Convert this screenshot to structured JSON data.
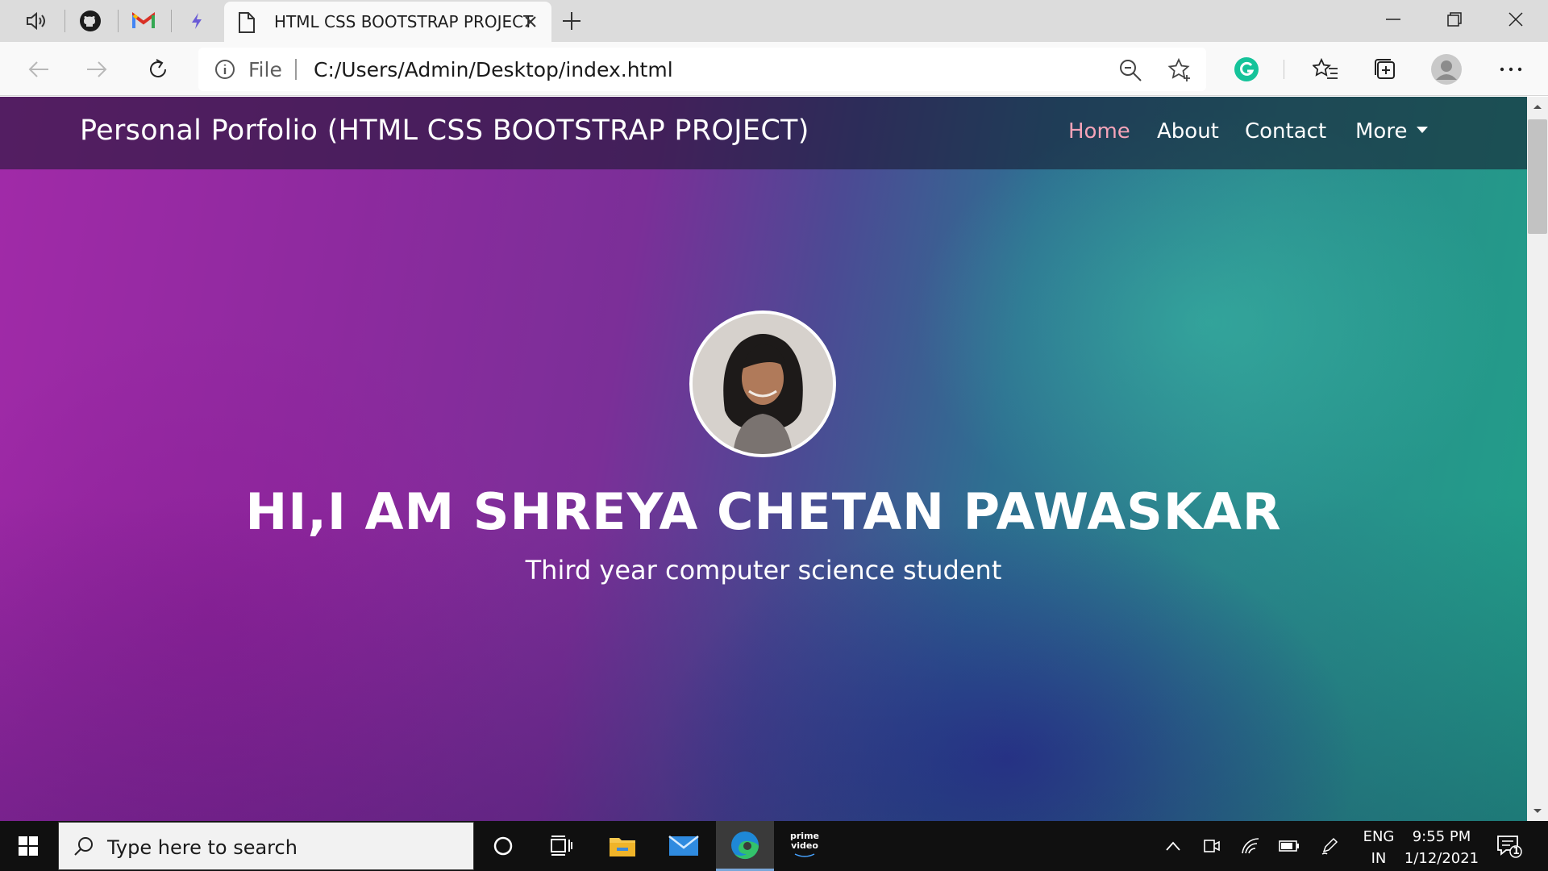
{
  "browser": {
    "tab_title": "HTML CSS BOOTSTRAP PROJECT",
    "omnibox_scheme": "File",
    "url": "C:/Users/Admin/Desktop/index.html"
  },
  "page": {
    "brand": "Personal Porfolio (HTML CSS BOOTSTRAP PROJECT)",
    "nav": [
      {
        "label": "Home",
        "active": true
      },
      {
        "label": "About",
        "active": false
      },
      {
        "label": "Contact",
        "active": false
      },
      {
        "label": "More",
        "active": false
      }
    ],
    "hero_title": "HI,I AM SHREYA CHETAN PAWASKAR",
    "hero_subtitle": "Third year computer science student"
  },
  "taskbar": {
    "search_placeholder": "Type here to search",
    "lang_top": "ENG",
    "lang_bottom": "IN",
    "time": "9:55 PM",
    "date": "1/12/2021",
    "notification_count": "1",
    "prime_label_1": "prime",
    "prime_label_2": "video"
  },
  "colors": {
    "nav_active": "#f4a3b8",
    "hero_left": "#a12aa8",
    "hero_right": "#21a088"
  },
  "icons": [
    "speaker-icon",
    "github-icon",
    "gmail-icon",
    "extension-icon",
    "document-icon",
    "close-icon",
    "plus-icon",
    "minimize-icon",
    "restore-icon",
    "window-close-icon",
    "back-icon",
    "forward-icon",
    "refresh-icon",
    "info-icon",
    "zoom-out-icon",
    "star-icon",
    "grammarly-icon",
    "favorites-icon",
    "collections-icon",
    "profile-icon",
    "more-icon",
    "windows-icon",
    "search-icon",
    "cortana-icon",
    "task-view-icon",
    "file-explorer-icon",
    "mail-icon",
    "edge-icon",
    "prime-video-icon",
    "chevron-up-icon",
    "meet-now-icon",
    "wifi-icon",
    "battery-icon",
    "pen-icon",
    "notification-icon"
  ]
}
